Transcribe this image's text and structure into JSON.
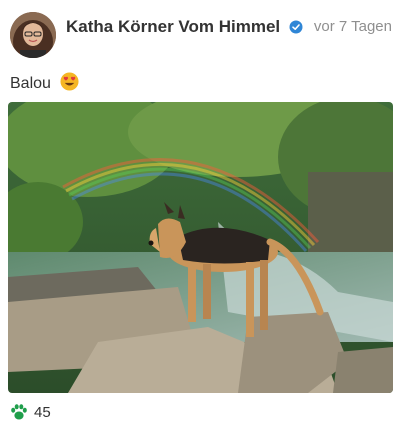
{
  "post": {
    "author_name": "Katha Körner Vom Himmel",
    "verified": true,
    "timestamp": "vor 7 Tagen",
    "caption_text": "Balou",
    "caption_emoji": "heart-eyes-emoji",
    "likes_count": "45"
  },
  "icons": {
    "verified": "verified-check-icon",
    "like": "paw-icon"
  },
  "colors": {
    "verified_blue": "#2f86d6",
    "paw_green": "#1f9e4b",
    "emoji_yellow": "#f5b623",
    "emoji_heart": "#e23a3a"
  }
}
